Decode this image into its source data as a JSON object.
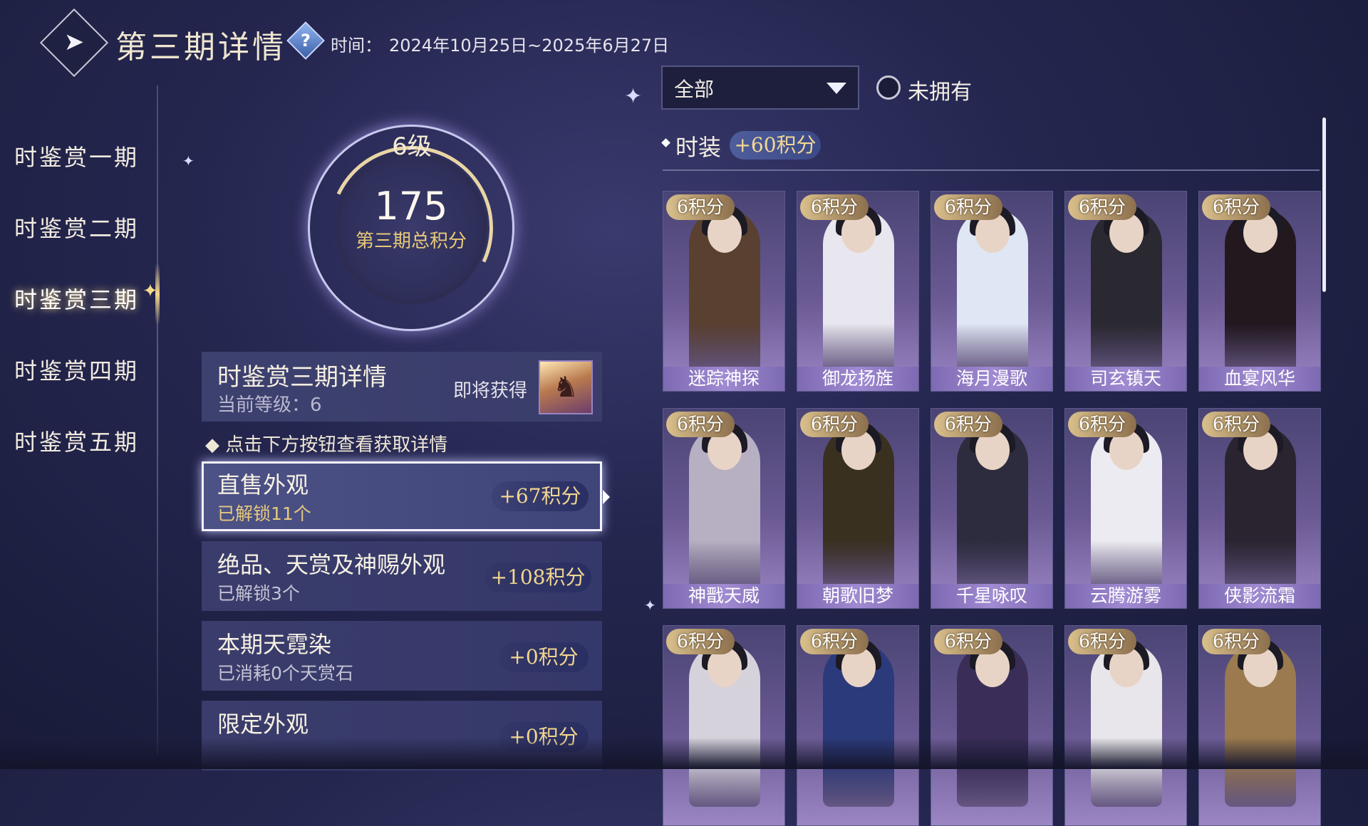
{
  "header": {
    "title": "第三期详情",
    "help_icon": "question-diamond-icon",
    "time_label": "时间：",
    "time_value": "2024年10月25日~2025年6月27日"
  },
  "sidebar": {
    "items": [
      {
        "label": "时鉴赏一期",
        "active": false
      },
      {
        "label": "时鉴赏二期",
        "active": false
      },
      {
        "label": "时鉴赏三期",
        "active": true
      },
      {
        "label": "时鉴赏四期",
        "active": false
      },
      {
        "label": "时鉴赏五期",
        "active": false
      }
    ]
  },
  "level_ring": {
    "level": "6级",
    "score": "175",
    "score_label": "第三期总积分"
  },
  "detail_card": {
    "title": "时鉴赏三期详情",
    "current_level": "当前等级：6",
    "soon_label": "即将获得"
  },
  "hint": "◆ 点击下方按钮查看获取详情",
  "sources": [
    {
      "title": "直售外观",
      "sub": "已解锁11个",
      "points": "+67积分",
      "selected": true
    },
    {
      "title": "绝品、天赏及神赐外观",
      "sub": "已解锁3个",
      "points": "+108积分",
      "selected": false
    },
    {
      "title": "本期天霓染",
      "sub": "已消耗0个天赏石",
      "points": "+0积分",
      "selected": false
    },
    {
      "title": "限定外观",
      "sub": "",
      "points": "+0积分",
      "selected": false
    }
  ],
  "filter": {
    "selected": "全部",
    "unowned_label": "未拥有"
  },
  "section": {
    "title": "时装",
    "points": "+60积分"
  },
  "cards": [
    {
      "points": "6积分",
      "name": "迷踪神探",
      "accent": "#5a4030"
    },
    {
      "points": "6积分",
      "name": "御龙扬旌",
      "accent": "#e8e6ee"
    },
    {
      "points": "6积分",
      "name": "海月漫歌",
      "accent": "#dfe6f4"
    },
    {
      "points": "6积分",
      "name": "司玄镇天",
      "accent": "#2a2830"
    },
    {
      "points": "6积分",
      "name": "血宴风华",
      "accent": "#22181e"
    },
    {
      "points": "6积分",
      "name": "神戬天威",
      "accent": "#b7b0c2"
    },
    {
      "points": "6积分",
      "name": "朝歌旧梦",
      "accent": "#3a3020"
    },
    {
      "points": "6积分",
      "name": "千星咏叹",
      "accent": "#2c2c3e"
    },
    {
      "points": "6积分",
      "name": "云腾游雾",
      "accent": "#ecebf1"
    },
    {
      "points": "6积分",
      "name": "侠影流霜",
      "accent": "#2a2430"
    },
    {
      "points": "6积分",
      "name": "",
      "accent": "#d6d2dc"
    },
    {
      "points": "6积分",
      "name": "",
      "accent": "#2b3a7a"
    },
    {
      "points": "6积分",
      "name": "",
      "accent": "#3a2e58"
    },
    {
      "points": "6积分",
      "name": "",
      "accent": "#e8e6ea"
    },
    {
      "points": "6积分",
      "name": "",
      "accent": "#9a7a4e"
    }
  ]
}
